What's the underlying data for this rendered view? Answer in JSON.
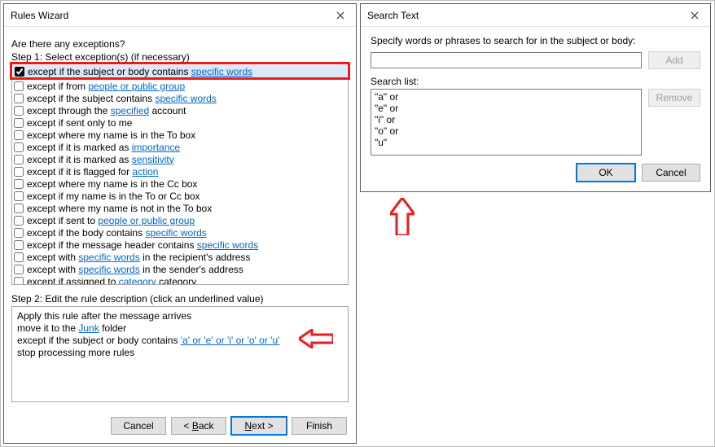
{
  "rules_wizard": {
    "title": "Rules Wizard",
    "question": "Are there any exceptions?",
    "step1_label": "Step 1: Select exception(s) (if necessary)",
    "exceptions": [
      {
        "checked": true,
        "pre": "except if the subject or body contains ",
        "link": "specific words",
        "post": "",
        "selected": true
      },
      {
        "checked": false,
        "pre": "except if from ",
        "link": "people or public group",
        "post": ""
      },
      {
        "checked": false,
        "pre": "except if the subject contains ",
        "link": "specific words",
        "post": ""
      },
      {
        "checked": false,
        "pre": "except through the ",
        "link": "specified",
        "post": " account"
      },
      {
        "checked": false,
        "pre": "except if sent only to me",
        "link": "",
        "post": ""
      },
      {
        "checked": false,
        "pre": "except where my name is in the To box",
        "link": "",
        "post": ""
      },
      {
        "checked": false,
        "pre": "except if it is marked as ",
        "link": "importance",
        "post": ""
      },
      {
        "checked": false,
        "pre": "except if it is marked as ",
        "link": "sensitivity",
        "post": ""
      },
      {
        "checked": false,
        "pre": "except if it is flagged for ",
        "link": "action",
        "post": ""
      },
      {
        "checked": false,
        "pre": "except where my name is in the Cc box",
        "link": "",
        "post": ""
      },
      {
        "checked": false,
        "pre": "except if my name is in the To or Cc box",
        "link": "",
        "post": ""
      },
      {
        "checked": false,
        "pre": "except where my name is not in the To box",
        "link": "",
        "post": ""
      },
      {
        "checked": false,
        "pre": "except if sent to ",
        "link": "people or public group",
        "post": ""
      },
      {
        "checked": false,
        "pre": "except if the body contains ",
        "link": "specific words",
        "post": ""
      },
      {
        "checked": false,
        "pre": "except if the message header contains ",
        "link": "specific words",
        "post": ""
      },
      {
        "checked": false,
        "pre": "except with ",
        "link": "specific words",
        "post": " in the recipient's address"
      },
      {
        "checked": false,
        "pre": "except with ",
        "link": "specific words",
        "post": " in the sender's address"
      },
      {
        "checked": false,
        "pre": "except if assigned to ",
        "link": "category",
        "post": " category"
      }
    ],
    "step2_label": "Step 2: Edit the rule description (click an underlined value)",
    "desc": {
      "line1": "Apply this rule after the message arrives",
      "line2_pre": "move it to the ",
      "line2_link": "Junk",
      "line2_post": " folder",
      "line3_pre": "except if the subject or body contains ",
      "line3_link": "'a' or 'e' or 'i' or 'o' or 'u'",
      "line4": "stop processing more rules"
    },
    "buttons": {
      "cancel": "Cancel",
      "back_pre": "< ",
      "back_key": "B",
      "back_post": "ack",
      "next_key": "N",
      "next_post": "ext >",
      "finish": "Finish"
    }
  },
  "search_text": {
    "title": "Search Text",
    "prompt": "Specify words or phrases to search for in the subject or body:",
    "input_value": "",
    "add": "Add",
    "list_label": "Search list:",
    "items": [
      "\"a\" or",
      "\"e\" or",
      "\"i\" or",
      "\"o\" or",
      "\"u\""
    ],
    "remove": "Remove",
    "ok": "OK",
    "cancel": "Cancel"
  }
}
